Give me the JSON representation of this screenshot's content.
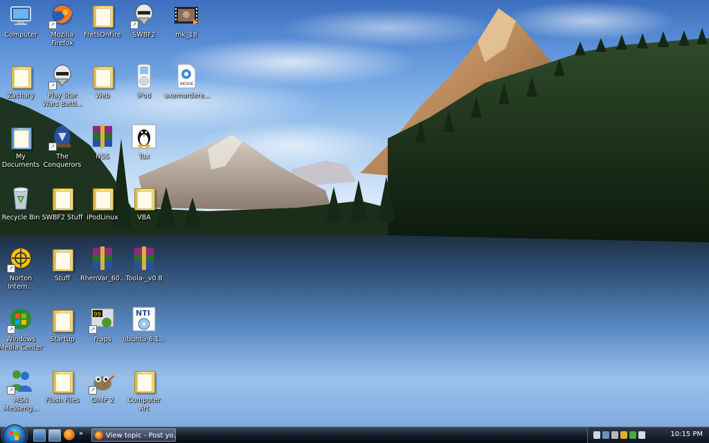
{
  "desktop": {
    "icons": [
      {
        "label": "Computer",
        "icon": "computer-icon"
      },
      {
        "label": "Mozilla Firefox",
        "icon": "firefox-icon"
      },
      {
        "label": "FretsOnFire",
        "icon": "folder-icon"
      },
      {
        "label": "SWBF2",
        "icon": "game-helmet-icon"
      },
      {
        "label": "mk_18",
        "icon": "video-file-icon"
      },
      {
        "label": "Zachary",
        "icon": "folder-icon"
      },
      {
        "label": "Play Star Wars Battl...",
        "icon": "game-helmet-icon"
      },
      {
        "label": "Web",
        "icon": "folder-icon"
      },
      {
        "label": "iPod",
        "icon": "ipod-icon"
      },
      {
        "label": "axemurdere...",
        "icon": "quicktime-movie-icon"
      },
      {
        "label": "My Documents",
        "icon": "my-documents-icon"
      },
      {
        "label": "The Conquerors",
        "icon": "game-icon"
      },
      {
        "label": "NSS",
        "icon": "winrar-icon"
      },
      {
        "label": "Tux",
        "icon": "tux-penguin-icon"
      },
      {
        "label": "Recycle Bin",
        "icon": "recycle-bin-icon"
      },
      {
        "label": "SWBF2 Stuff",
        "icon": "folder-icon"
      },
      {
        "label": "iPodLinux",
        "icon": "folder-icon"
      },
      {
        "label": "VBA",
        "icon": "folder-icon"
      },
      {
        "label": "Norton Intern...",
        "icon": "norton-icon"
      },
      {
        "label": "Stuff",
        "icon": "folder-icon"
      },
      {
        "label": "RhenVar_60...",
        "icon": "winrar-icon"
      },
      {
        "label": "Toola-_v0.8",
        "icon": "winrar-icon"
      },
      {
        "label": "Windows Media Center",
        "icon": "media-center-icon"
      },
      {
        "label": "Startup",
        "icon": "folder-icon"
      },
      {
        "label": "Fraps",
        "icon": "fraps-icon"
      },
      {
        "label": "ubuntu-6.1...",
        "icon": "nero-image-icon"
      },
      {
        "label": "MSN Messeng...",
        "icon": "msn-messenger-icon"
      },
      {
        "label": "Flash Files",
        "icon": "folder-icon"
      },
      {
        "label": "GIMP 2",
        "icon": "gimp-icon"
      },
      {
        "label": "Computer Art",
        "icon": "folder-icon"
      }
    ]
  },
  "taskbar": {
    "start_icon": "windows-start-orb-icon",
    "quick_launch": [
      "show-desktop-icon",
      "switch-windows-icon",
      "firefox-icon"
    ],
    "more": "»",
    "task_button_label": "View topic - Post yo...",
    "tray_icons": [
      "network-icon",
      "display-icon",
      "printer-icon",
      "security-shield-icon",
      "sync-icon",
      "volume-icon"
    ],
    "clock": "10:15 PM"
  }
}
